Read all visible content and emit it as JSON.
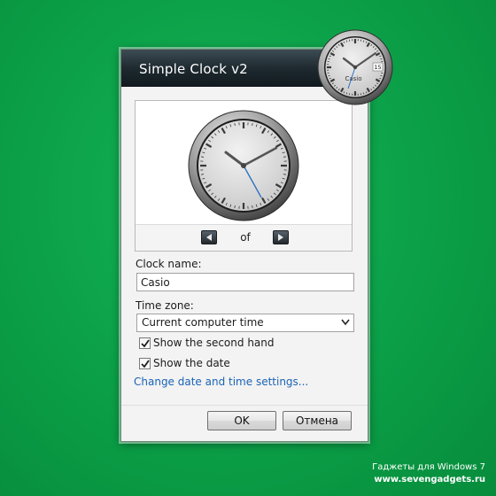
{
  "dialog": {
    "title": "Simple Clock v2",
    "preview": {
      "nav_label": "of",
      "prev_icon": "arrow-left-icon",
      "next_icon": "arrow-right-icon"
    },
    "clock_name": {
      "label": "Clock name:",
      "value": "Casio"
    },
    "time_zone": {
      "label": "Time zone:",
      "value": "Current computer time"
    },
    "options": {
      "second_hand": {
        "label": "Show the second hand",
        "checked": true
      },
      "date": {
        "label": "Show the date",
        "checked": true
      }
    },
    "link": "Change date and time settings...",
    "buttons": {
      "ok": "OK",
      "cancel": "Отмена"
    }
  },
  "gadget": {
    "brand": "Casio",
    "date": "15"
  },
  "watermark": {
    "line1": "Гаджеты для Windows 7",
    "line2": "www.sevengadgets.ru"
  },
  "colors": {
    "desktop": "#0ea24b",
    "titlebar": "#1e2a30",
    "link": "#1b63b6",
    "second_hand": "#2a6fc2"
  }
}
